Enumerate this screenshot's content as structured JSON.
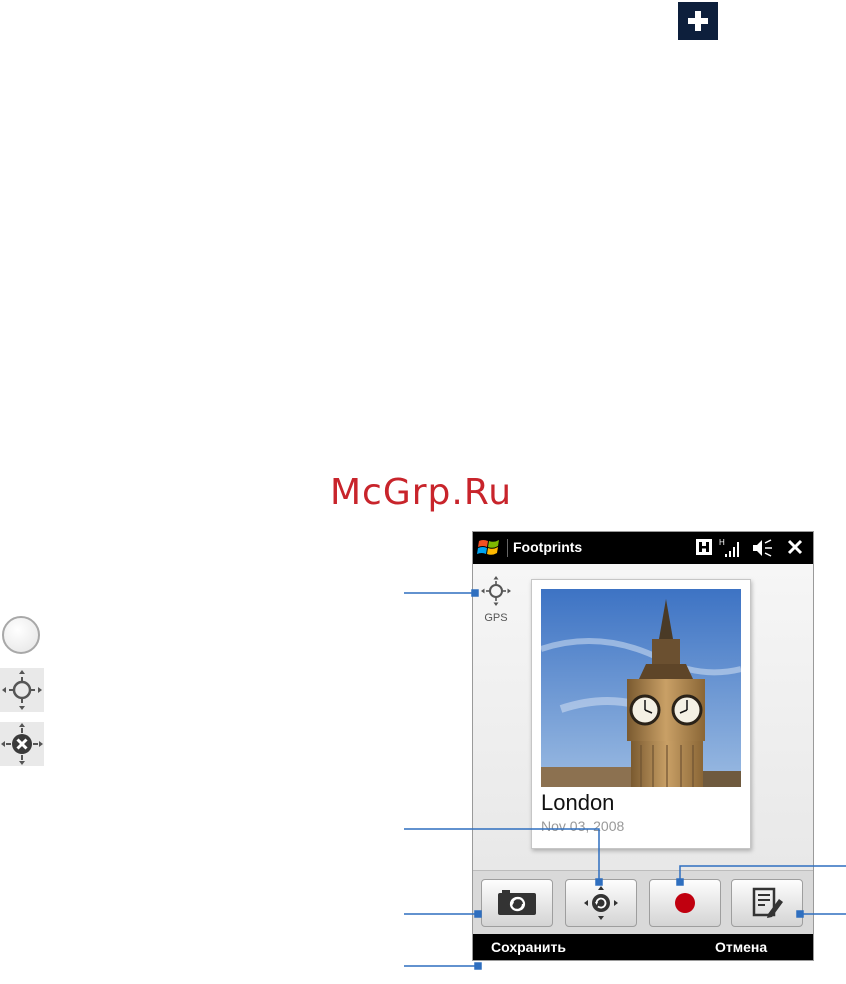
{
  "watermark": "McGrp.Ru",
  "legend": {
    "icons": [
      "gps-off-icon",
      "gps-on-icon",
      "gps-failed-icon"
    ]
  },
  "phone": {
    "titlebar": {
      "app_title": "Footprints",
      "icons": [
        "windows-start-icon",
        "keyboard-lock-icon",
        "signal-strength-icon",
        "volume-muted-icon",
        "close-icon"
      ]
    },
    "gps_label": "GPS",
    "card": {
      "title": "London",
      "date": "Nov 03, 2008",
      "photo": "big-ben-photo"
    },
    "toolbar": {
      "buttons": [
        "camera-switch-icon",
        "gps-refresh-icon",
        "record-icon",
        "edit-note-icon"
      ]
    },
    "softkeys": {
      "left": "Сохранить",
      "right": "Отмена"
    }
  },
  "colors": {
    "watermark": "#c8242b",
    "callout_line": "#2f6fbf",
    "titlebar": "#000000",
    "record": "#c0000f"
  }
}
